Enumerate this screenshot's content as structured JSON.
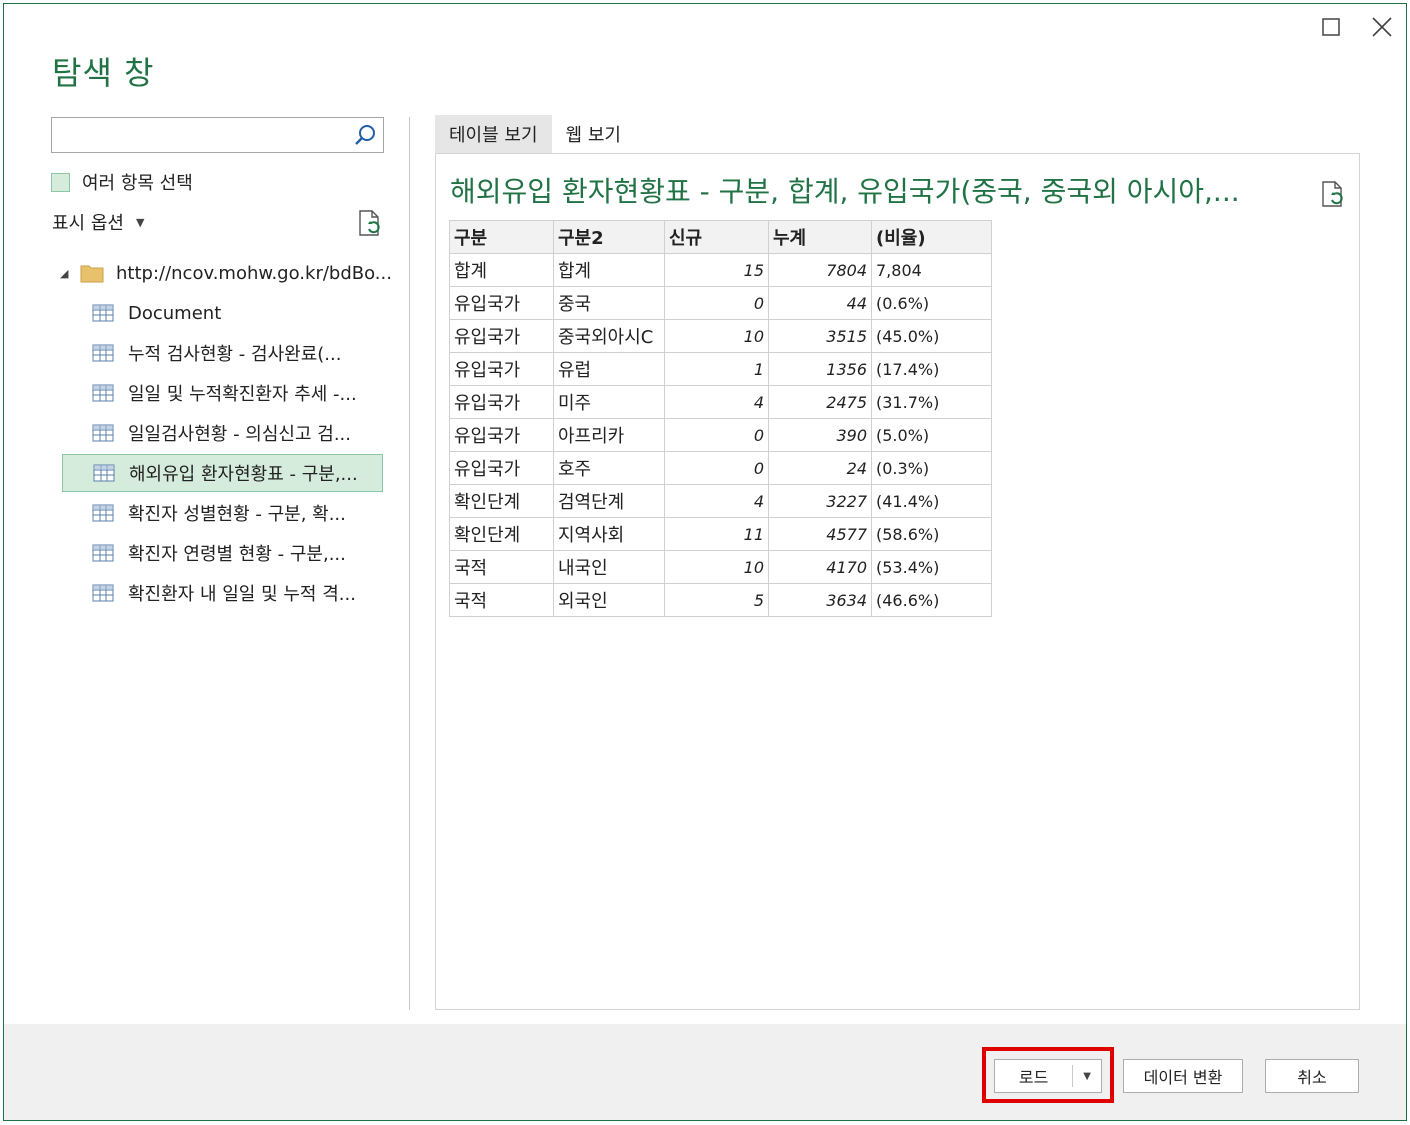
{
  "window": {
    "title": "탐색 창"
  },
  "left_pane": {
    "search": {
      "value": "",
      "placeholder": ""
    },
    "multi_select_label": "여러 항목 선택",
    "display_options_label": "표시 옵션",
    "tree": {
      "root_label": "http://ncov.mohw.go.kr/bdBo...",
      "items": [
        {
          "label": "Document",
          "selected": false
        },
        {
          "label": "누적 검사현황 - 검사완료(...",
          "selected": false
        },
        {
          "label": "일일 및 누적확진환자 추세 -...",
          "selected": false
        },
        {
          "label": "일일검사현황 - 의심신고 검...",
          "selected": false
        },
        {
          "label": "해외유입 환자현황표 - 구분,...",
          "selected": true
        },
        {
          "label": "확진자 성별현황 - 구분, 확...",
          "selected": false
        },
        {
          "label": "확진자 연령별 현황 - 구분,...",
          "selected": false
        },
        {
          "label": "확진환자 내 일일 및 누적 격...",
          "selected": false
        }
      ]
    }
  },
  "right_pane": {
    "tabs": [
      {
        "label": "테이블 보기",
        "active": true
      },
      {
        "label": "웹 보기",
        "active": false
      }
    ],
    "preview_title": "해외유입 환자현황표 - 구분, 합계, 유입국가(중국, 중국외 아시아,...",
    "table": {
      "headers": [
        "구분",
        "구분2",
        "신규",
        "누계",
        "(비율)"
      ],
      "rows": [
        [
          "합계",
          "합계",
          "15",
          "7804",
          "7,804"
        ],
        [
          "유입국가",
          "중국",
          "0",
          "44",
          "(0.6%)"
        ],
        [
          "유입국가",
          "중국외아시C",
          "10",
          "3515",
          "(45.0%)"
        ],
        [
          "유입국가",
          "유럽",
          "1",
          "1356",
          "(17.4%)"
        ],
        [
          "유입국가",
          "미주",
          "4",
          "2475",
          "(31.7%)"
        ],
        [
          "유입국가",
          "아프리카",
          "0",
          "390",
          "(5.0%)"
        ],
        [
          "유입국가",
          "호주",
          "0",
          "24",
          "(0.3%)"
        ],
        [
          "확인단계",
          "검역단계",
          "4",
          "3227",
          "(41.4%)"
        ],
        [
          "확인단계",
          "지역사회",
          "11",
          "4577",
          "(58.6%)"
        ],
        [
          "국적",
          "내국인",
          "10",
          "4170",
          "(53.4%)"
        ],
        [
          "국적",
          "외국인",
          "5",
          "3634",
          "(46.6%)"
        ]
      ]
    }
  },
  "footer": {
    "load_label": "로드",
    "transform_label": "데이터 변환",
    "cancel_label": "취소"
  },
  "colors": {
    "accent_green": "#217346",
    "selection_bg": "#d5ecdc",
    "highlight_red": "#e00000"
  },
  "icons": [
    "maximize-icon",
    "close-icon",
    "search-icon",
    "refresh-icon",
    "folder-icon",
    "table-icon",
    "chevron-down-icon",
    "collapse-triangle-icon"
  ]
}
